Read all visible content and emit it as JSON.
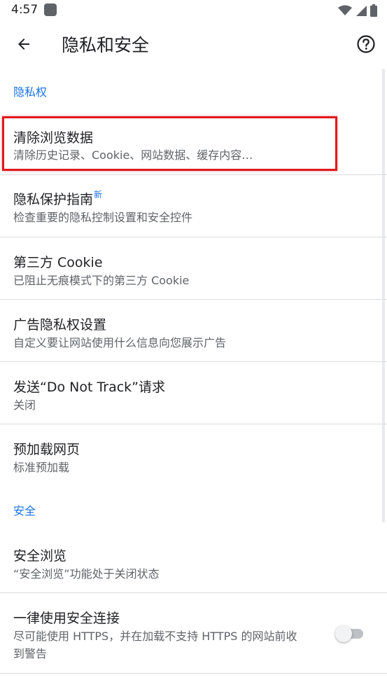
{
  "status_bar": {
    "time": "4:57",
    "icons": [
      "notification-square-icon",
      "wifi-icon",
      "signal-icon",
      "battery-icon"
    ]
  },
  "app_bar": {
    "title": "隐私和安全",
    "back_icon": "arrow-back-icon",
    "help_icon": "help-circle-icon"
  },
  "sections": {
    "privacy_header": "隐私权",
    "security_header": "安全"
  },
  "items": {
    "clear_data": {
      "title": "清除浏览数据",
      "subtitle": "清除历史记录、Cookie、网站数据、缓存内容…"
    },
    "privacy_guide": {
      "title": "隐私保护指南",
      "badge": "新",
      "subtitle": "检查重要的隐私控制设置和安全控件"
    },
    "third_party_cookie": {
      "title": "第三方 Cookie",
      "subtitle": "已阻止无痕模式下的第三方 Cookie"
    },
    "ad_privacy": {
      "title": "广告隐私权设置",
      "subtitle": "自定义要让网站使用什么信息向您展示广告"
    },
    "do_not_track": {
      "title": "发送“Do Not Track”请求",
      "subtitle": "关闭"
    },
    "preload": {
      "title": "预加载网页",
      "subtitle": "标准预加载"
    },
    "safe_browsing": {
      "title": "安全浏览",
      "subtitle": "“安全浏览”功能处于关闭状态"
    },
    "https_first": {
      "title": "一律使用安全连接",
      "subtitle_line1": "尽可能使用 HTTPS，并在加载不支持 HTTPS 的网站前收",
      "subtitle_line2": "到警告",
      "toggle_on": false
    }
  },
  "colors": {
    "accent": "#1a73e8",
    "highlight": "#e0191b",
    "text_primary": "#202124",
    "text_secondary": "#5f6368",
    "divider": "#dadce0"
  }
}
